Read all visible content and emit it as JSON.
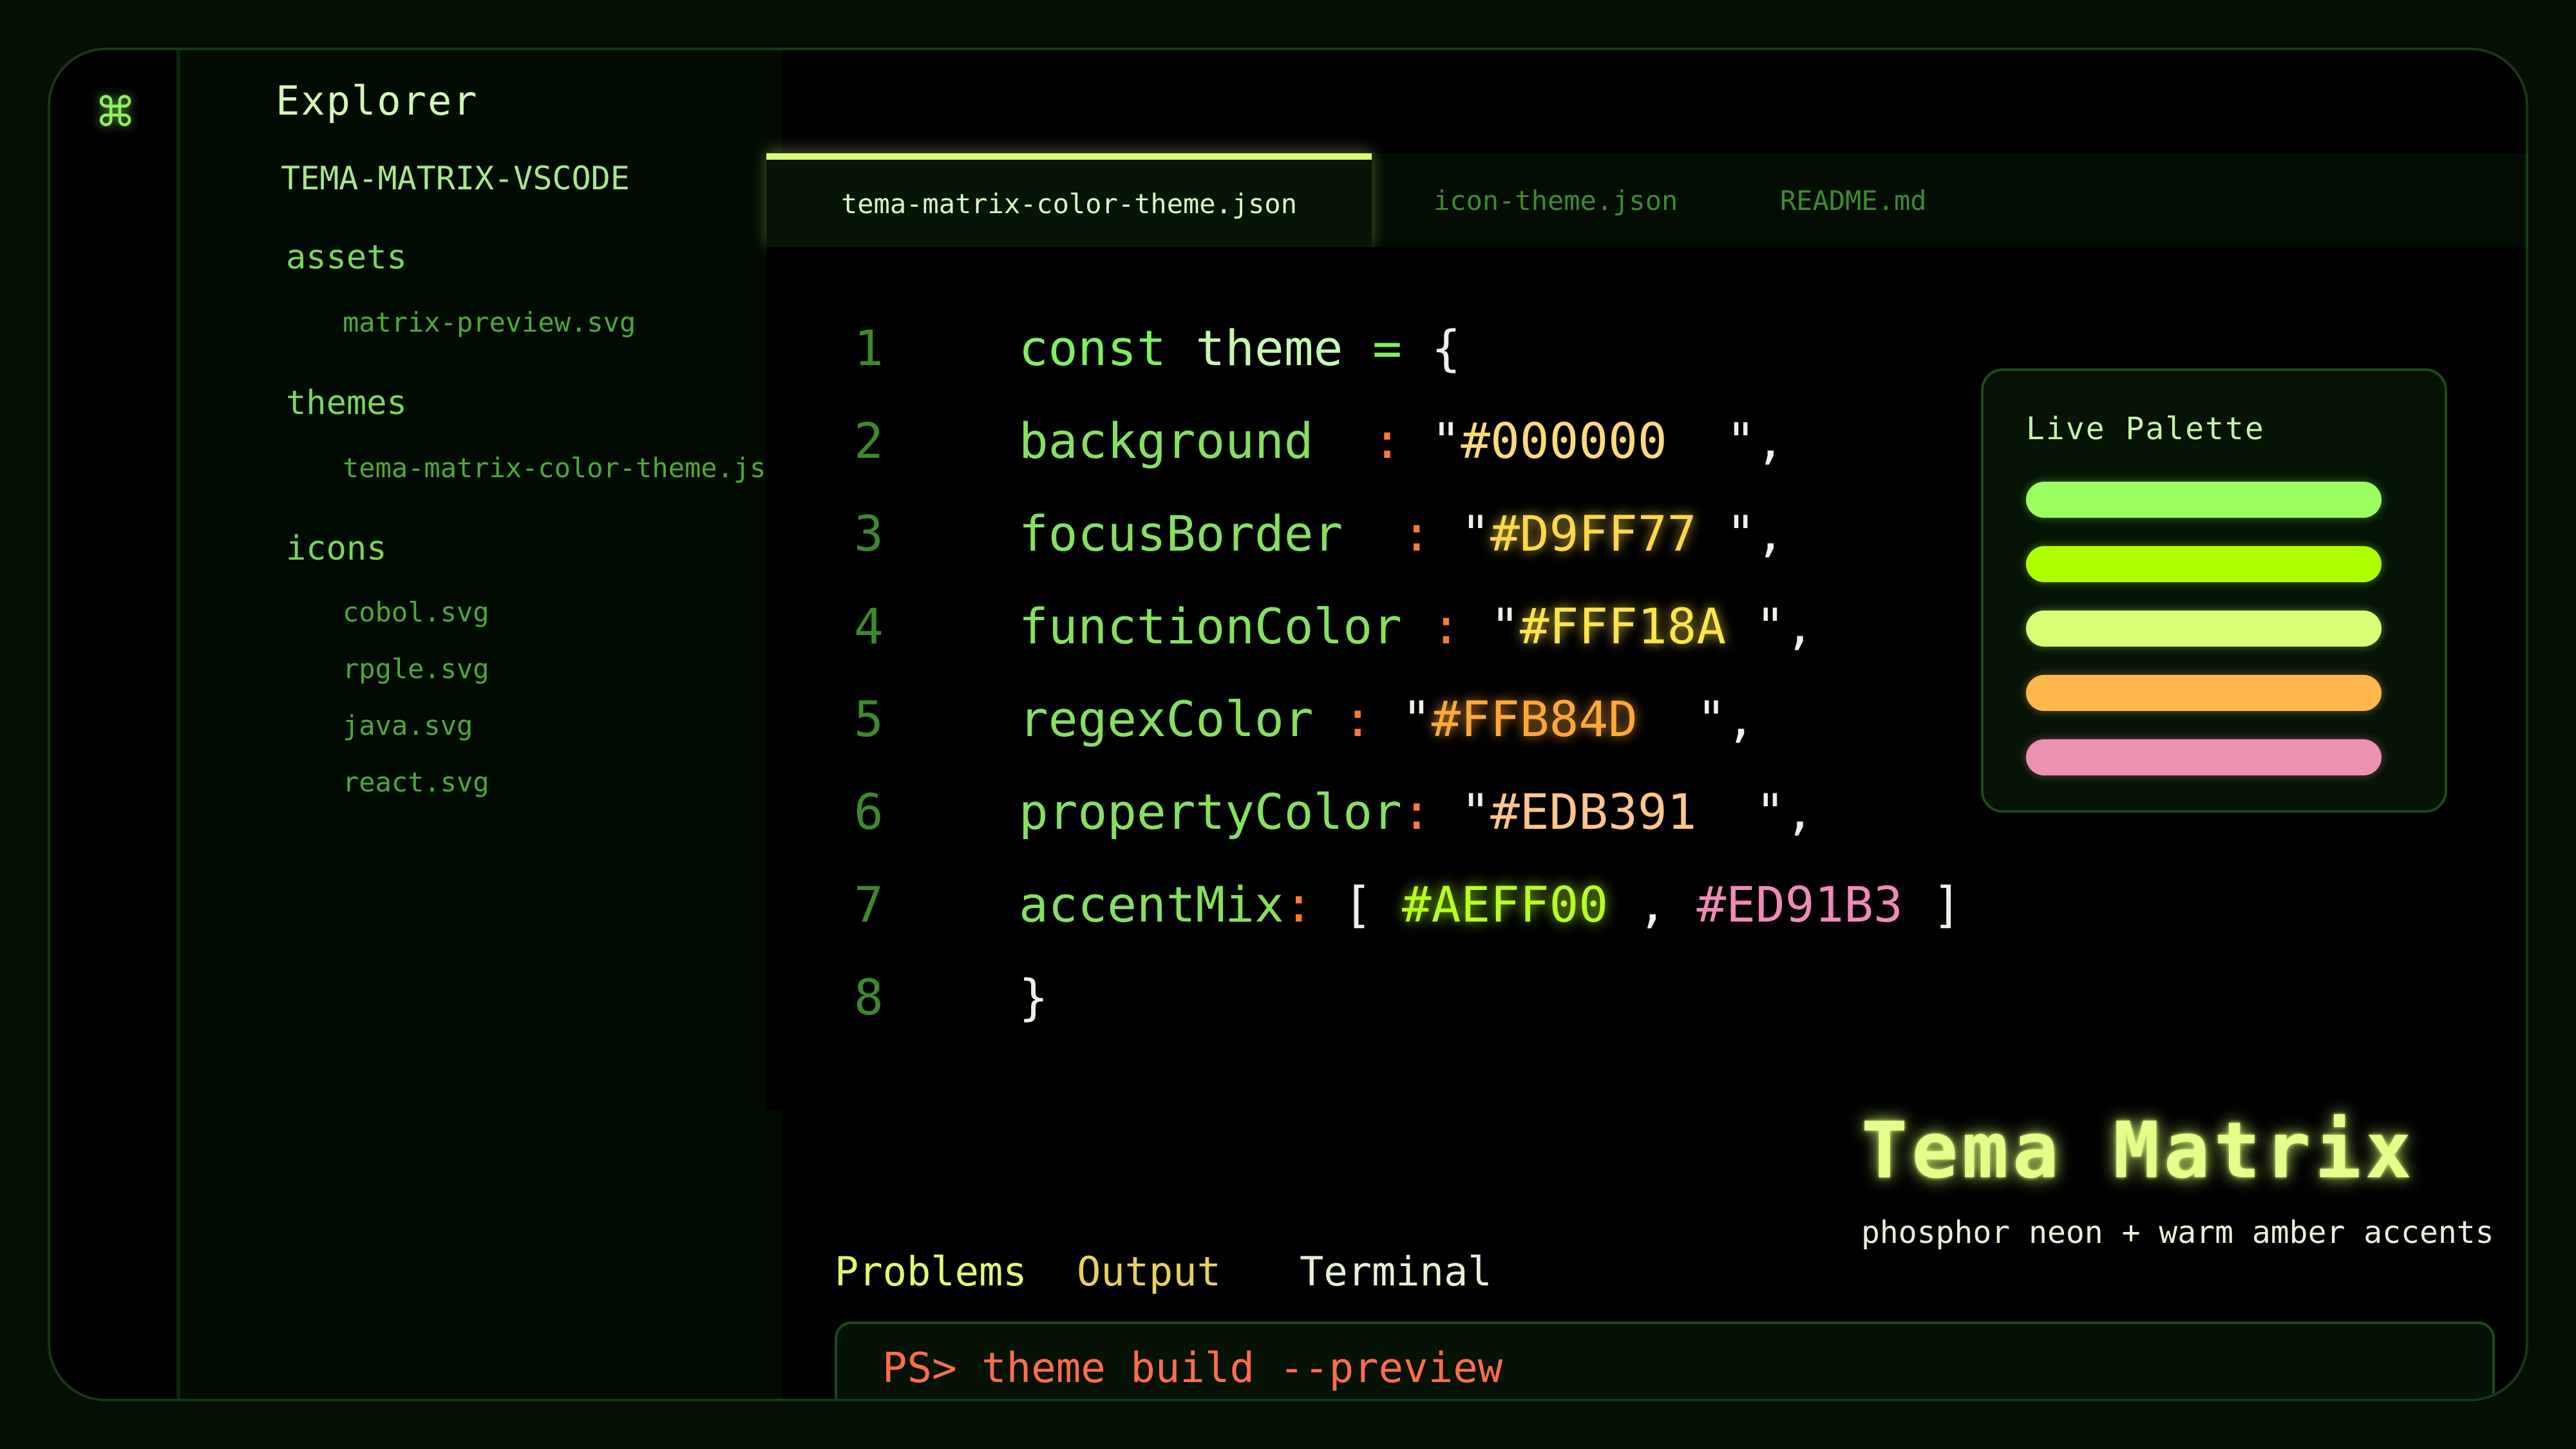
{
  "app": {
    "icon": "command-icon",
    "explorer_title": "Explorer",
    "project_title": "TEMA-MATRIX-VSCODE"
  },
  "sidebar": {
    "folders": [
      {
        "name": "assets",
        "files": [
          "matrix-preview.svg"
        ]
      },
      {
        "name": "themes",
        "files": [
          "tema-matrix-color-theme.json"
        ]
      },
      {
        "name": "icons",
        "files": [
          "cobol.svg",
          "rpgle.svg",
          "java.svg",
          "react.svg"
        ]
      }
    ]
  },
  "tabs": [
    {
      "label": "tema-matrix-color-theme.json",
      "active": true
    },
    {
      "label": "icon-theme.json",
      "active": false
    },
    {
      "label": "README.md",
      "active": false
    }
  ],
  "code": {
    "line_numbers": [
      "1",
      "2",
      "3",
      "4",
      "5",
      "6",
      "7",
      "8"
    ],
    "line1": {
      "kw": "const",
      "id": "theme",
      "op": "=",
      "brace": "{"
    },
    "line2": {
      "prop": "background",
      "colon": ":",
      "q1": "\"",
      "value": "#000000",
      "q2": "\",",
      "sep": ""
    },
    "line3": {
      "prop": "focusBorder",
      "colon": ":",
      "q1": "\"",
      "value": "#D9FF77",
      "q2": "\","
    },
    "line4": {
      "prop": "functionColor",
      "colon": ":",
      "q1": "\"",
      "value": "#FFF18A",
      "q2": "\","
    },
    "line5": {
      "prop": "regexColor",
      "colon": ":",
      "q1": "\"",
      "value": "#FFB84D",
      "q2": "\","
    },
    "line6": {
      "prop": "propertyColor",
      "colon": ":",
      "q1": "\"",
      "value": "#EDB391",
      "q2": "\","
    },
    "line7": {
      "prop": "accentMix",
      "colon": ":",
      "open": "[",
      "value1": "#AEFF00",
      "comma": ",",
      "value2": "#ED91B3",
      "close": "]"
    },
    "line8": {
      "brace": "}"
    }
  },
  "palette": {
    "title": "Live Palette",
    "swatches": [
      "#9BFF62",
      "#AEFF00",
      "#D9FF77",
      "#FFB84D",
      "#ED91B3"
    ]
  },
  "brand": {
    "title": "Tema Matrix",
    "tagline": "phosphor neon + warm amber accents"
  },
  "panel": {
    "tabs": [
      "Problems",
      "Output",
      "Terminal"
    ],
    "terminal_command": "PS> theme build --preview"
  },
  "colors": {
    "background": "#000000",
    "accent": "#D9FF77",
    "border": "#1D4A1D"
  }
}
